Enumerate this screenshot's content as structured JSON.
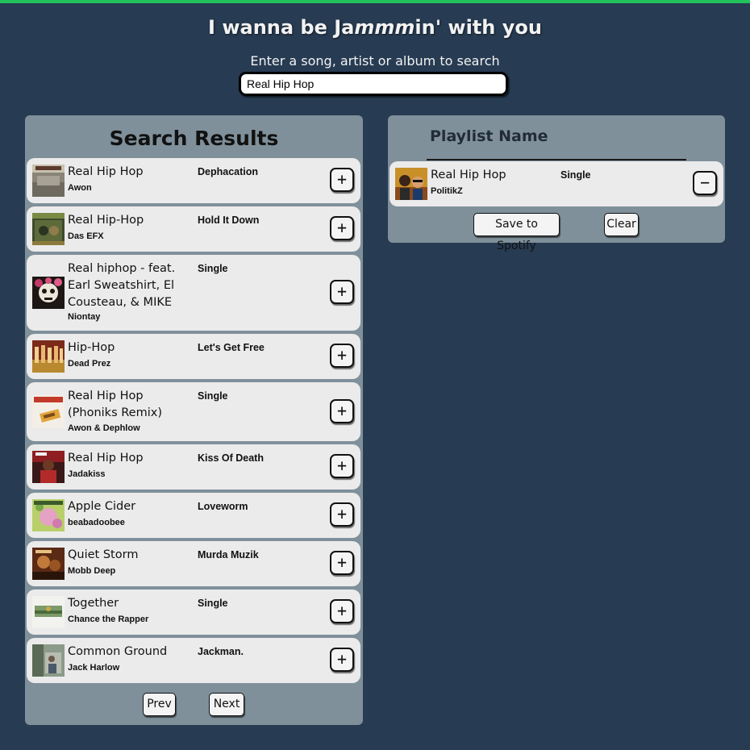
{
  "header": {
    "title_prefix": "I wanna be Ja",
    "title_emph": "mmm",
    "title_suffix": "in' with you",
    "search_label": "Enter a song, artist or album to search"
  },
  "search": {
    "value": "Real Hip Hop"
  },
  "results": {
    "title": "Search Results",
    "tracks": [
      {
        "name": "Real Hip Hop",
        "artist": "Awon",
        "album": "Dephacation",
        "action": "+"
      },
      {
        "name": "Real Hip-Hop",
        "artist": "Das EFX",
        "album": "Hold It Down",
        "action": "+"
      },
      {
        "name": "Real hiphop - feat. Earl Sweatshirt, El Cousteau, & MIKE",
        "artist": "Niontay",
        "album": "Single",
        "action": "+"
      },
      {
        "name": "Hip-Hop",
        "artist": "Dead Prez",
        "album": "Let's Get Free",
        "action": "+"
      },
      {
        "name": "Real Hip Hop (Phoniks Remix)",
        "artist": "Awon & Dephlow",
        "album": "Single",
        "action": "+"
      },
      {
        "name": "Real Hip Hop",
        "artist": "Jadakiss",
        "album": "Kiss Of Death",
        "action": "+"
      },
      {
        "name": "Apple Cider",
        "artist": "beabadoobee",
        "album": "Loveworm",
        "action": "+"
      },
      {
        "name": "Quiet Storm",
        "artist": "Mobb Deep",
        "album": "Murda Muzik",
        "action": "+"
      },
      {
        "name": "Together",
        "artist": "Chance the Rapper",
        "album": "Single",
        "action": "+"
      },
      {
        "name": "Common Ground",
        "artist": "Jack Harlow",
        "album": "Jackman.",
        "action": "+"
      }
    ],
    "prev_label": "Prev",
    "next_label": "Next"
  },
  "playlist": {
    "name": "Playlist Name",
    "tracks": [
      {
        "name": "Real Hip Hop",
        "artist": "PolitikZ",
        "album": "Single",
        "action": "−"
      }
    ],
    "save_label": "Save to Spotify",
    "clear_label": "Clear"
  },
  "colors": {
    "background": "#273b52",
    "accent_bar": "#22c35a",
    "panel": "#7f909b",
    "track_row": "#ebebeb"
  }
}
